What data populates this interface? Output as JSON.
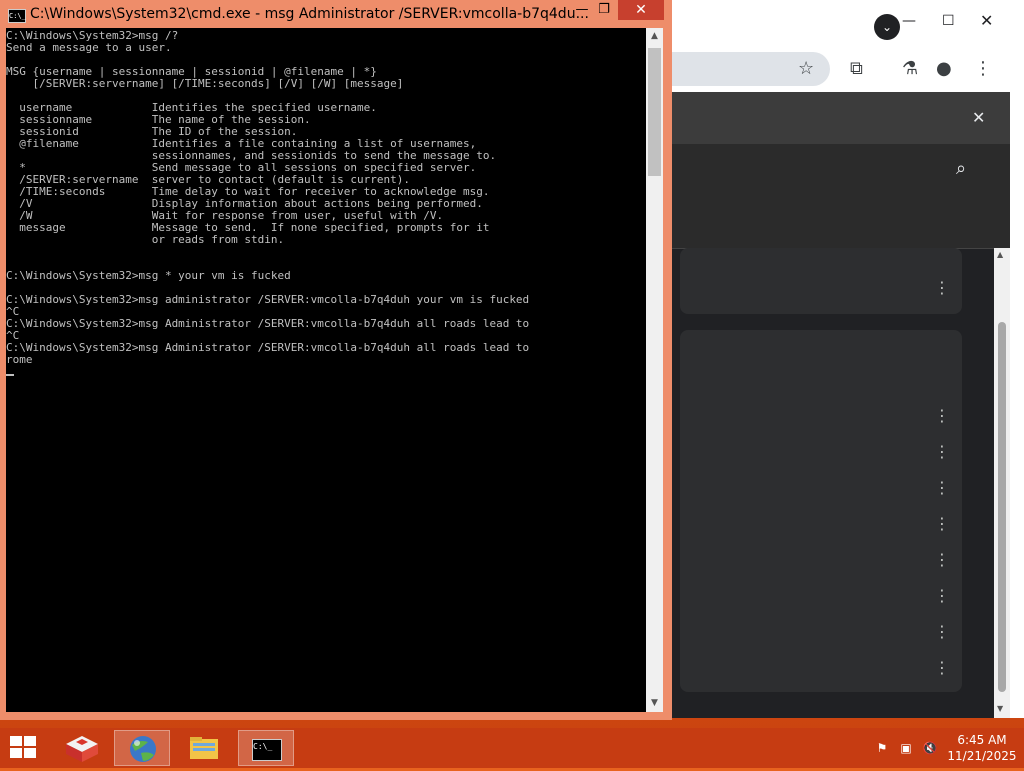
{
  "cmd": {
    "title": "C:\\Windows\\System32\\cmd.exe - msg  Administrator /SERVER:vmcolla-b7q4du...",
    "icon_label": "C:\\_",
    "lines": [
      "C:\\Windows\\System32>msg /?",
      "Send a message to a user.",
      "",
      "MSG {username | sessionname | sessionid | @filename | *}",
      "    [/SERVER:servername] [/TIME:seconds] [/V] [/W] [message]",
      "",
      "  username            Identifies the specified username.",
      "  sessionname         The name of the session.",
      "  sessionid           The ID of the session.",
      "  @filename           Identifies a file containing a list of usernames,",
      "                      sessionnames, and sessionids to send the message to.",
      "  *                   Send message to all sessions on specified server.",
      "  /SERVER:servername  server to contact (default is current).",
      "  /TIME:seconds       Time delay to wait for receiver to acknowledge msg.",
      "  /V                  Display information about actions being performed.",
      "  /W                  Wait for response from user, useful with /V.",
      "  message             Message to send.  If none specified, prompts for it",
      "                      or reads from stdin.",
      "",
      "",
      "C:\\Windows\\System32>msg * your vm is fucked",
      "",
      "C:\\Windows\\System32>msg administrator /SERVER:vmcolla-b7q4duh your vm is fucked",
      "^C",
      "C:\\Windows\\System32>msg Administrator /SERVER:vmcolla-b7q4duh all roads lead to",
      "^C",
      "C:\\Windows\\System32>msg Administrator /SERVER:vmcolla-b7q4duh all roads lead to",
      "rome"
    ]
  },
  "browser": {
    "kebab_icon": "⋮"
  },
  "taskbar": {
    "time": "6:45 AM",
    "date": "11/21/2025",
    "cmd_icon_label": "C:\\_"
  }
}
